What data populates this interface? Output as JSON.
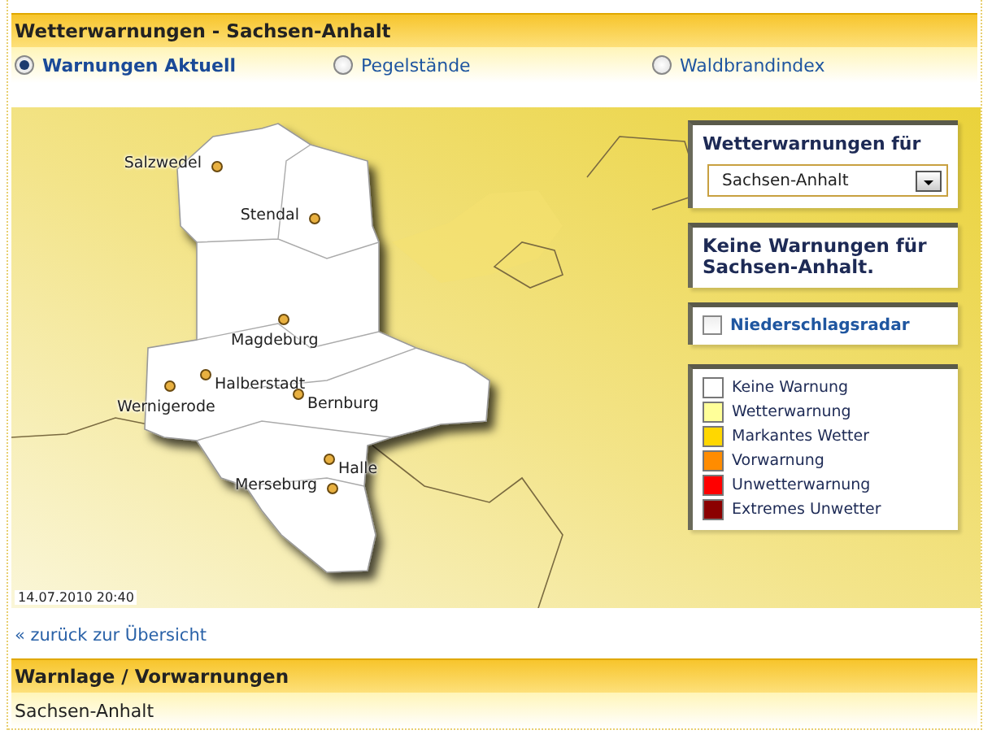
{
  "header": {
    "title": "Wetterwarnungen - Sachsen-Anhalt"
  },
  "tabs": [
    {
      "label": "Warnungen Aktuell",
      "selected": true
    },
    {
      "label": "Pegelstände",
      "selected": false
    },
    {
      "label": "Waldbrandindex",
      "selected": false
    }
  ],
  "map": {
    "cities": [
      {
        "name": "Salzwedel"
      },
      {
        "name": "Stendal"
      },
      {
        "name": "Magdeburg"
      },
      {
        "name": "Halberstadt"
      },
      {
        "name": "Wernigerode"
      },
      {
        "name": "Bernburg"
      },
      {
        "name": "Halle"
      },
      {
        "name": "Merseburg"
      }
    ],
    "timestamp": "14.07.2010 20:40"
  },
  "region_box": {
    "title": "Wetterwarnungen für",
    "dropdown": {
      "value": "Sachsen-Anhalt"
    }
  },
  "notice": "Keine Warnungen für Sachsen-Anhalt.",
  "radar": {
    "label": "Niederschlagsradar",
    "checked": false
  },
  "legend": [
    {
      "label": "Keine Warnung",
      "color": "#ffffff"
    },
    {
      "label": "Wetterwarnung",
      "color": "#ffff99"
    },
    {
      "label": "Markantes Wetter",
      "color": "#ffd700"
    },
    {
      "label": "Vorwarnung",
      "color": "#ff8c00"
    },
    {
      "label": "Unwetterwarnung",
      "color": "#ff0000"
    },
    {
      "label": "Extremes Unwetter",
      "color": "#8b0000"
    }
  ],
  "back_link": "« zurück zur Übersicht",
  "section": {
    "title": "Warnlage / Vorwarnungen",
    "text": "Sachsen-Anhalt"
  }
}
